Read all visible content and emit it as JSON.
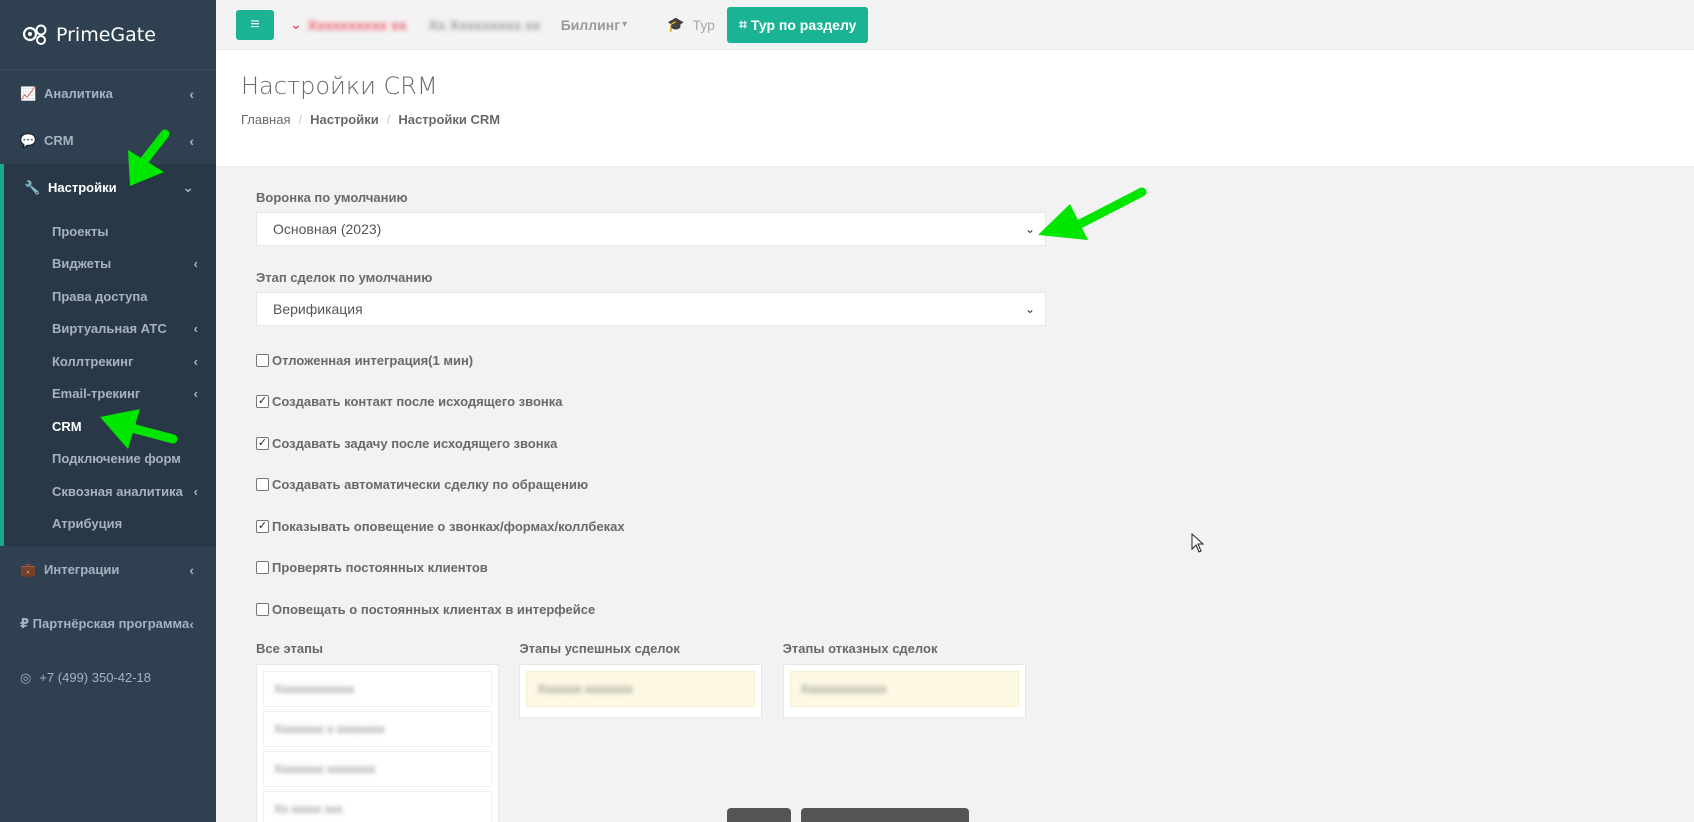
{
  "brand": {
    "name": "PrimeGate"
  },
  "sidebar": {
    "items": [
      {
        "label": "Аналитика",
        "icon": "chart-line-icon"
      },
      {
        "label": "CRM",
        "icon": "chat-icon"
      },
      {
        "label": "Настройки",
        "icon": "wrench-icon"
      }
    ],
    "submenu": [
      {
        "label": "Проекты"
      },
      {
        "label": "Виджеты"
      },
      {
        "label": "Права доступа"
      },
      {
        "label": "Виртуальная АТС"
      },
      {
        "label": "Коллтрекинг"
      },
      {
        "label": "Email-трекинг"
      },
      {
        "label": "CRM"
      },
      {
        "label": "Подключение форм"
      },
      {
        "label": "Сквозная аналитика"
      },
      {
        "label": "Атрибуция"
      }
    ],
    "bottom_items": [
      {
        "label": "Интеграции",
        "icon": "briefcase-icon"
      },
      {
        "label": "Партнёрская программа",
        "icon": "ruble-icon"
      }
    ],
    "phone": "+7 (499) 350-42-18"
  },
  "topbar": {
    "billing": "Биллинг",
    "tour": "Тур",
    "tour_section": "Тур по разделу"
  },
  "heading": {
    "title": "Настройки CRM",
    "breadcrumb": [
      "Главная",
      "Настройки",
      "Настройки CRM"
    ]
  },
  "form": {
    "funnel_label": "Воронка по умолчанию",
    "funnel_value": "Основная (2023)",
    "stage_label": "Этап сделок по умолчанию",
    "stage_value": "Верификация",
    "checkboxes": [
      {
        "label": "Отложенная интеграция(1 мин)",
        "checked": false
      },
      {
        "label": "Создавать контакт после исходящего звонка",
        "checked": true
      },
      {
        "label": "Создавать задачу после исходящего звонка",
        "checked": true
      },
      {
        "label": "Создавать автоматически сделку по обращению",
        "checked": false
      },
      {
        "label": "Показывать оповещение о звонках/формах/коллбеках",
        "checked": true
      },
      {
        "label": "Проверять постоянных клиентов",
        "checked": false
      },
      {
        "label": "Оповещать о постоянных клиентах в интерфейсе",
        "checked": false
      }
    ],
    "all_stages_label": "Все этапы",
    "success_stages_label": "Этапы успешных сделок",
    "fail_stages_label": "Этапы отказных сделок"
  },
  "colors": {
    "accent": "#1ab394",
    "sidebar": "#2f4050",
    "annotation_arrow": "#00e600"
  }
}
